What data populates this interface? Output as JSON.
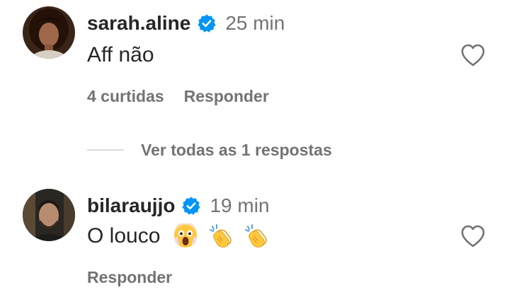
{
  "comments": [
    {
      "username": "sarah.aline",
      "time": "25 min",
      "text": "Aff não",
      "likes": "4 curtidas",
      "reply_label": "Responder",
      "verified": true,
      "avatar_icon": "avatar-photo-woman",
      "like_icon": "heart-outline-icon"
    },
    {
      "username": "bilaraujjo",
      "time": "19 min",
      "text": "O louco",
      "emojis": [
        "face-screaming-emoji",
        "clapping-hands-emoji",
        "clapping-hands-emoji"
      ],
      "reply_label": "Responder",
      "verified": true,
      "avatar_icon": "avatar-photo-man",
      "like_icon": "heart-outline-icon"
    }
  ],
  "view_replies": {
    "label": "Ver todas as 1 respostas"
  },
  "colors": {
    "text_primary": "#262626",
    "text_secondary": "#737373",
    "verified_blue": "#0095f6",
    "divider": "#dbdbdb"
  }
}
